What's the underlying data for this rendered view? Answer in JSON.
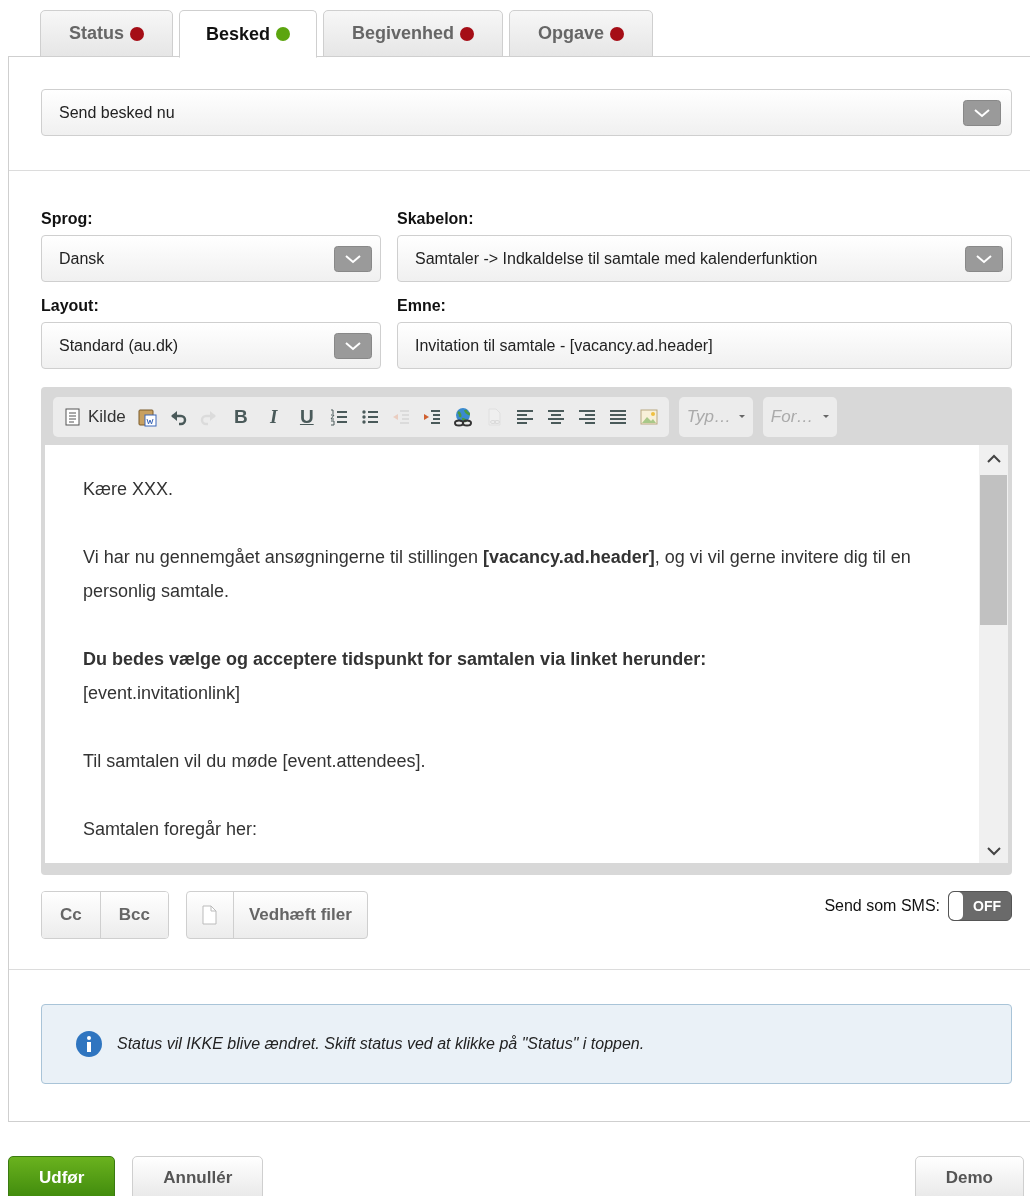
{
  "tabs": [
    {
      "label": "Status",
      "selected": false,
      "color": "#a50d16"
    },
    {
      "label": "Besked",
      "selected": true,
      "color": "#5ca50f"
    },
    {
      "label": "Begivenhed",
      "selected": false,
      "color": "#a50d16"
    },
    {
      "label": "Opgave",
      "selected": false,
      "color": "#a50d16"
    }
  ],
  "action_select": {
    "value": "Send besked nu"
  },
  "fields": [
    {
      "label": "Sprog:",
      "kind": "select",
      "value": "Dansk"
    },
    {
      "label": "Skabelon:",
      "kind": "select",
      "value": "Samtaler -> Indkaldelse til samtale med kalenderfunktion"
    },
    {
      "label": "Layout:",
      "kind": "select",
      "value": "Standard (au.dk)"
    },
    {
      "label": "Emne:",
      "kind": "text",
      "value": "Invitation til samtale - [vacancy.ad.header]"
    }
  ],
  "toolbar": {
    "buttons": [
      {
        "kind": "source",
        "label": "Kilde",
        "disabled": false
      },
      {
        "kind": "paste-word",
        "disabled": false
      },
      {
        "kind": "undo",
        "disabled": false
      },
      {
        "kind": "redo",
        "disabled": true
      },
      {
        "kind": "bold",
        "label": "B",
        "disabled": false
      },
      {
        "kind": "italic",
        "label": "I",
        "disabled": false
      },
      {
        "kind": "underline",
        "label": "U",
        "disabled": false
      },
      {
        "kind": "numbered-list",
        "disabled": false
      },
      {
        "kind": "bulleted-list",
        "disabled": false
      },
      {
        "kind": "outdent",
        "disabled": true
      },
      {
        "kind": "indent",
        "disabled": false
      },
      {
        "kind": "link",
        "disabled": false
      },
      {
        "kind": "anchor",
        "disabled": true
      },
      {
        "kind": "align-left",
        "disabled": false
      },
      {
        "kind": "align-center",
        "disabled": false
      },
      {
        "kind": "align-right",
        "disabled": false
      },
      {
        "kind": "justify",
        "disabled": false
      },
      {
        "kind": "image",
        "disabled": false
      }
    ],
    "dropdowns": [
      {
        "placeholder": "Typ…"
      },
      {
        "placeholder": "For…"
      }
    ]
  },
  "editor": {
    "paragraphs": [
      [
        "Kære XXX."
      ],
      [
        "Vi har nu gennemgået ansøgningerne til stillingen **[vacancy.ad.header]**, og vi vil gerne invitere dig til en personlig samtale."
      ],
      [
        "**Du bedes vælge og acceptere tidspunkt for samtalen via linket herunder:**",
        "[event.invitationlink]"
      ],
      [
        "Til samtalen vil du møde [event.attendees]."
      ],
      [
        "Samtalen foregår her:"
      ]
    ]
  },
  "recipients": [
    "Cc",
    "Bcc"
  ],
  "attach": {
    "label": "Vedhæft filer"
  },
  "sms": {
    "label": "Send som SMS:",
    "toggle_text": "OFF",
    "on": false
  },
  "info": {
    "text": "Status vil IKKE blive ændret. Skift status ved at klikke på \"Status\" i toppen."
  },
  "actions": [
    {
      "label": "Udfør",
      "kind": "primary"
    },
    {
      "label": "Annullér",
      "kind": "secondary"
    },
    {
      "label": "Demo",
      "kind": "secondary"
    }
  ]
}
